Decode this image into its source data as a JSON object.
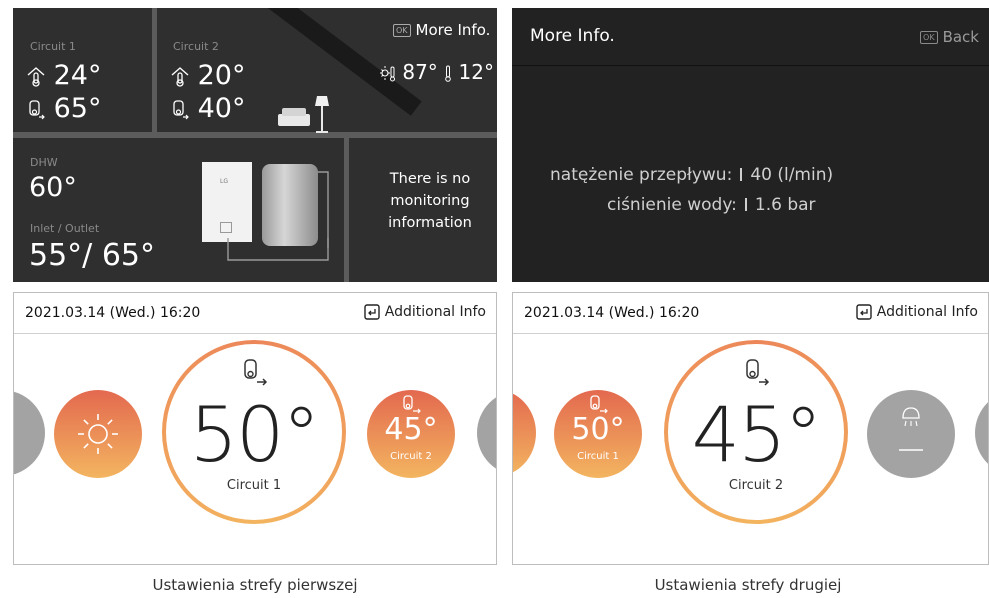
{
  "monitor": {
    "circuit1": {
      "label": "Circuit 1",
      "room_temp": "24°",
      "water_temp": "65°"
    },
    "circuit2": {
      "label": "Circuit 2",
      "room_temp": "20°",
      "water_temp": "40°"
    },
    "more_info_button": "More Info.",
    "ok_key": "OK",
    "outdoor_temp_1": "87°",
    "outdoor_temp_2": "12°",
    "dhw": {
      "label": "DHW",
      "value": "60°"
    },
    "inlet_outlet": {
      "label": "Inlet / Outlet",
      "value": "55°/ 65°"
    },
    "no_monitoring": "There is no monitoring information",
    "lg_logo": "LG"
  },
  "more_info": {
    "title": "More Info.",
    "back_button": "Back",
    "ok_key": "OK",
    "rows": [
      {
        "label": "natężenie przepływu:",
        "value": "40 (l/min)"
      },
      {
        "label": "ciśnienie wody:",
        "value": "1.6 bar"
      }
    ]
  },
  "zone1": {
    "datetime": "2021.03.14 (Wed.) 16:20",
    "additional_info": "Additional Info",
    "main_temp": "50°",
    "main_label": "Circuit 1",
    "side_temp": "45°",
    "side_label": "Circuit 2",
    "caption": "Ustawienia strefy pierwszej"
  },
  "zone2": {
    "datetime": "2021.03.14 (Wed.) 16:20",
    "additional_info": "Additional Info",
    "main_temp": "45°",
    "main_label": "Circuit 2",
    "side_temp": "50°",
    "side_label": "Circuit 1",
    "caption": "Ustawienia strefy drugiej"
  },
  "colors": {
    "accent_orange": "#ec8659",
    "accent_light": "#f3b55f",
    "dark_panel": "#2f2f2f",
    "grey_button": "#a3a3a3"
  }
}
